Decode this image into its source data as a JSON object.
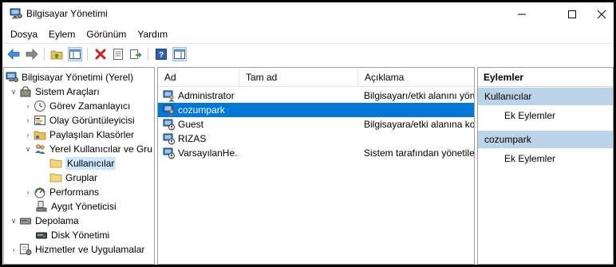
{
  "window": {
    "title": "Bilgisayar Yönetimi"
  },
  "menu": [
    "Dosya",
    "Eylem",
    "Görünüm",
    "Yardım"
  ],
  "tree": {
    "root": "Bilgisayar Yönetimi (Yerel)",
    "system_tools": "Sistem Araçları",
    "task_scheduler": "Görev Zamanlayıcı",
    "event_viewer": "Olay Görüntüleyicisi",
    "shared_folders": "Paylaşılan Klasörler",
    "local_users_groups": "Yerel Kullanıcılar ve Gru",
    "users": "Kullanıcılar",
    "groups": "Gruplar",
    "performance": "Performans",
    "device_manager": "Aygıt Yöneticisi",
    "storage": "Depolama",
    "disk_management": "Disk Yönetimi",
    "services_apps": "Hizmetler ve Uygulamalar"
  },
  "list": {
    "columns": [
      "Ad",
      "Tam ad",
      "Açıklama"
    ],
    "rows": [
      {
        "name": "Administrator",
        "full_name": "",
        "description": "Bilgisayarı/etki alanını yön"
      },
      {
        "name": "cozumpark",
        "full_name": "",
        "description": ""
      },
      {
        "name": "Guest",
        "full_name": "",
        "description": "Bilgisayara/etki alanına ko"
      },
      {
        "name": "RIZAS",
        "full_name": "",
        "description": ""
      },
      {
        "name": "VarsayılanHe...",
        "full_name": "",
        "description": "Sistem tarafından yönetile"
      }
    ],
    "selected_index": 1
  },
  "actions": {
    "title": "Eylemler",
    "group1": "Kullanıcılar",
    "group1_item": "Ek Eylemler",
    "group2": "cozumpark",
    "group2_item": "Ek Eylemler"
  },
  "colors": {
    "selection": "#0078d7",
    "tree_selection": "#cce8ff",
    "action_group": "#bcd4ea"
  }
}
